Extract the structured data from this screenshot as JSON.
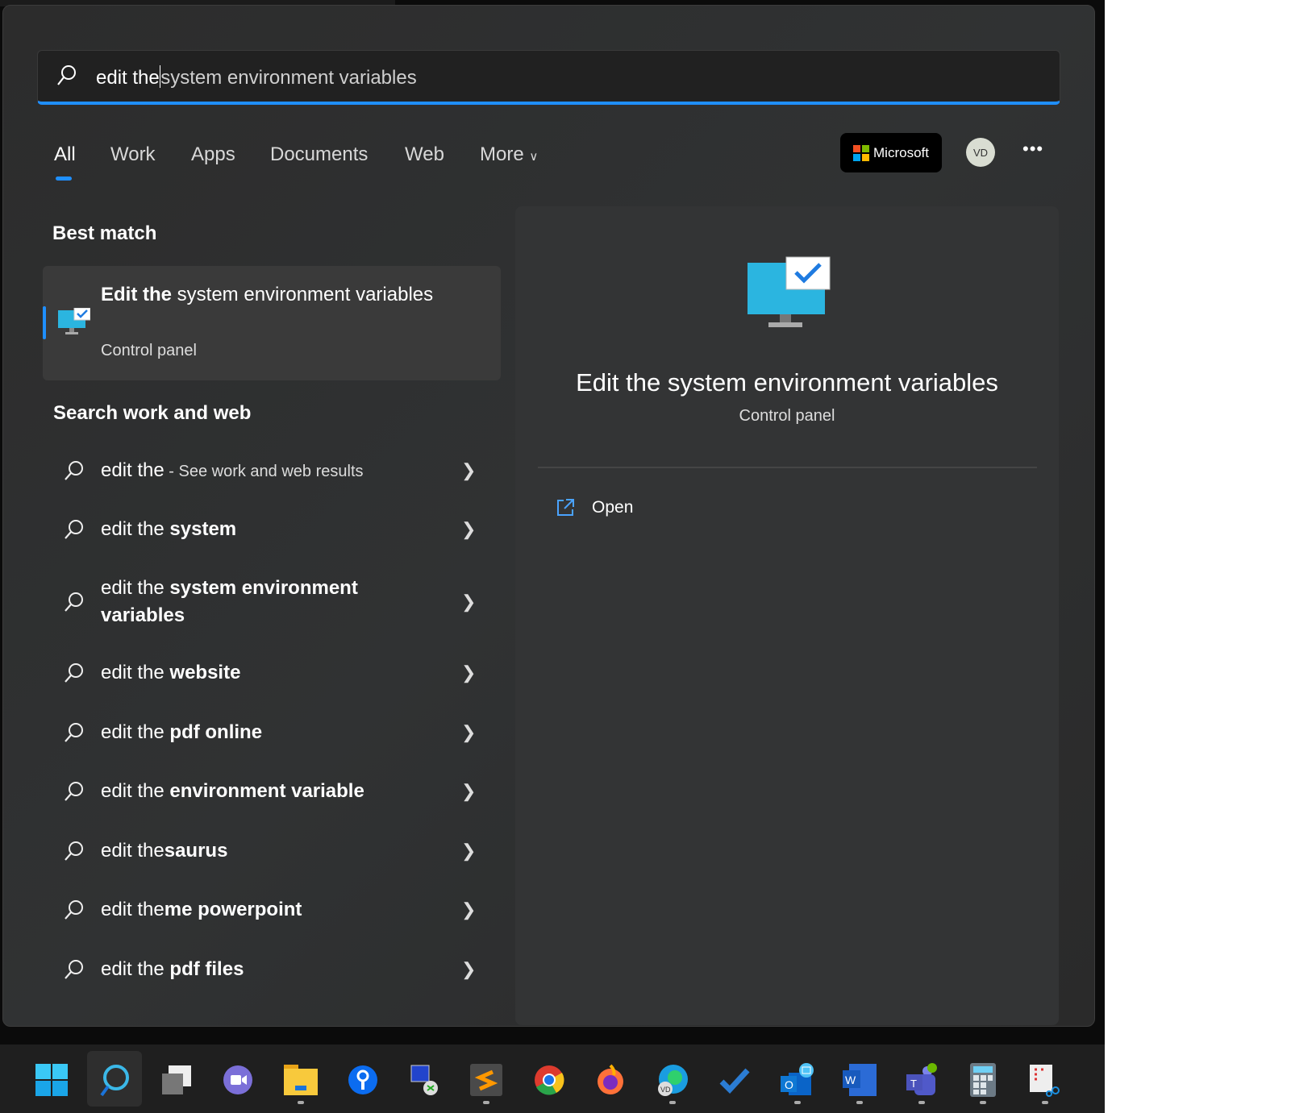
{
  "search": {
    "typed": "edit the",
    "suggestion": "system environment variables"
  },
  "tabs": [
    {
      "label": "All",
      "active": true
    },
    {
      "label": "Work"
    },
    {
      "label": "Apps"
    },
    {
      "label": "Documents"
    },
    {
      "label": "Web"
    },
    {
      "label": "More"
    }
  ],
  "header": {
    "microsoft_label": "Microsoft",
    "avatar_initials": "VD",
    "more_icon": "ellipsis-icon"
  },
  "best_match": {
    "heading": "Best match",
    "title_bold": "Edit the",
    "title_rest": " system environment variables",
    "subtitle": "Control panel"
  },
  "search_web": {
    "heading": "Search work and web",
    "items": [
      {
        "prefix": "edit the",
        "bold": "",
        "suffix": " - See work and web results"
      },
      {
        "prefix": "edit the ",
        "bold": "system",
        "suffix": ""
      },
      {
        "prefix": "edit the ",
        "bold": "system environment variables",
        "suffix": ""
      },
      {
        "prefix": "edit the ",
        "bold": "website",
        "suffix": ""
      },
      {
        "prefix": "edit the ",
        "bold": "pdf online",
        "suffix": ""
      },
      {
        "prefix": "edit the ",
        "bold": "environment variable",
        "suffix": ""
      },
      {
        "prefix": "edit the",
        "bold": "saurus",
        "suffix": ""
      },
      {
        "prefix": "edit the",
        "bold": "me powerpoint",
        "suffix": ""
      },
      {
        "prefix": "edit the ",
        "bold": "pdf files",
        "suffix": ""
      }
    ]
  },
  "preview": {
    "title": "Edit the system environment variables",
    "subtitle": "Control panel",
    "actions": [
      {
        "label": "Open",
        "icon": "open-external-icon"
      }
    ]
  },
  "taskbar": {
    "apps": [
      {
        "name": "start",
        "running": false
      },
      {
        "name": "search",
        "running": false,
        "active": true
      },
      {
        "name": "task-view",
        "running": false
      },
      {
        "name": "chat",
        "running": false
      },
      {
        "name": "file-explorer",
        "running": true
      },
      {
        "name": "keepass",
        "running": false
      },
      {
        "name": "remote-desktop",
        "running": false
      },
      {
        "name": "sublime-text",
        "running": true
      },
      {
        "name": "chrome",
        "running": false
      },
      {
        "name": "firefox",
        "running": false
      },
      {
        "name": "edge",
        "running": true
      },
      {
        "name": "todo",
        "running": false
      },
      {
        "name": "outlook",
        "running": true
      },
      {
        "name": "word",
        "running": true
      },
      {
        "name": "teams",
        "running": true
      },
      {
        "name": "calculator",
        "running": true
      },
      {
        "name": "snipping-tool",
        "running": true
      }
    ]
  },
  "colors": {
    "accent": "#1f8fff"
  }
}
